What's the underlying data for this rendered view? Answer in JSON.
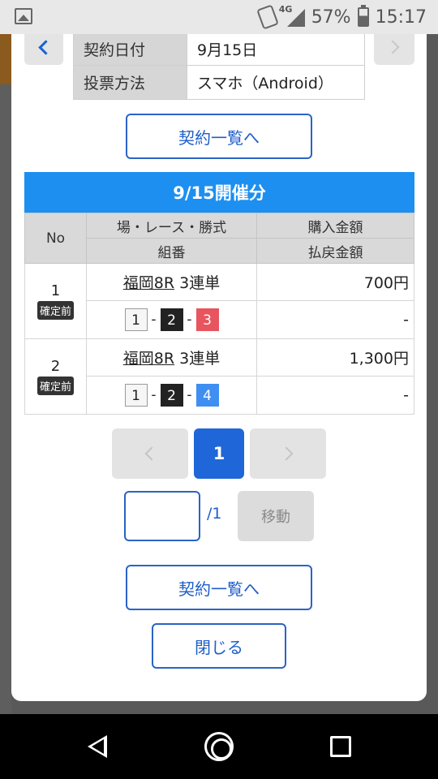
{
  "status_bar": {
    "network": "4G",
    "battery": "57%",
    "time": "15:17"
  },
  "contract_info": [
    {
      "label": "契約日付",
      "value": "9月15日"
    },
    {
      "label": "投票方法",
      "value": "スマホ（Android）"
    }
  ],
  "buttons": {
    "contract_list": "契約一覧へ",
    "close": "閉じる",
    "move": "移動"
  },
  "section_title": "9/15開催分",
  "table_headers": {
    "no": "No",
    "race_info": "場・レース・勝式",
    "combination": "組番",
    "purchase": "購入金額",
    "payout": "払戻金額"
  },
  "bets": [
    {
      "no": "1",
      "status": "確定前",
      "venue_race": "福岡8R",
      "bet_type": "3連単",
      "first": "1",
      "second": "2",
      "third": "3",
      "purchase": "700円",
      "payout": "-"
    },
    {
      "no": "2",
      "status": "確定前",
      "venue_race": "福岡8R",
      "bet_type": "3連単",
      "first": "1",
      "second": "2",
      "third": "4",
      "purchase": "1,300円",
      "payout": "-"
    }
  ],
  "pagination": {
    "current": "1",
    "total": "/1",
    "input_value": ""
  },
  "icons": {
    "back": "chevron-left-icon",
    "forward": "chevron-right-icon"
  },
  "colors": {
    "header_blue": "#1d8ff0",
    "accent_blue": "#1f66d9",
    "chip_red": "#e8555f",
    "chip_blue": "#3f8ff2"
  }
}
